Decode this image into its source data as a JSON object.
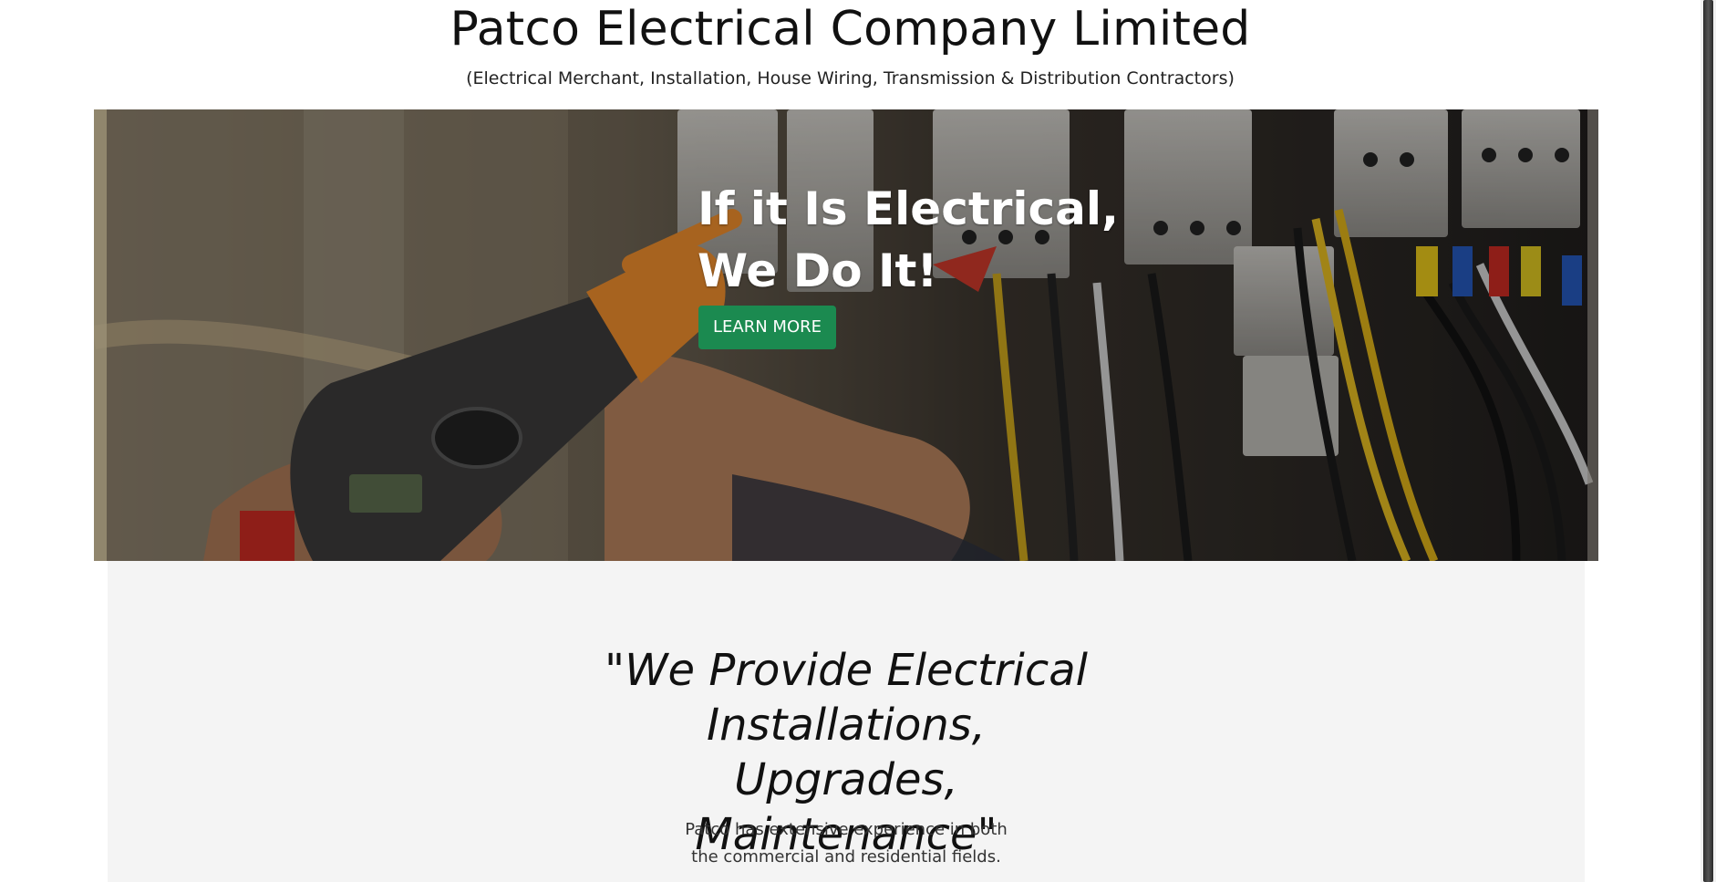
{
  "header": {
    "title": "Patco Electrical Company Limited",
    "subtitle": "(Electrical Merchant, Installation, House Wiring, Transmission & Distribution Contractors)"
  },
  "hero": {
    "heading_line1": "If it Is Electrical,",
    "heading_line2": "We Do It!",
    "button_label": "LEARN MORE",
    "button_color": "#1b8a50",
    "image_icon": "electrician-multimeter-photo"
  },
  "about": {
    "heading": "\"We Provide Electrical Installations, Upgrades, Maintenance\"",
    "text": "Patco has extensive experience in both the commercial and residential fields."
  }
}
